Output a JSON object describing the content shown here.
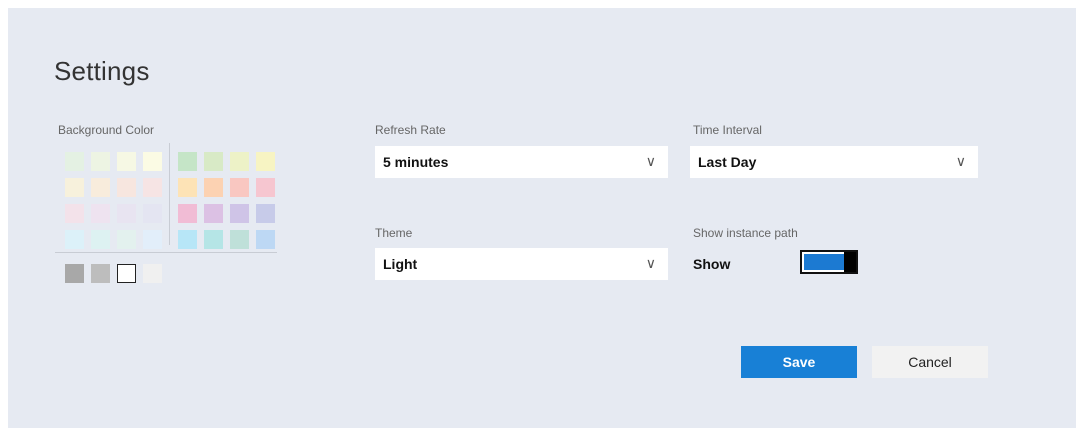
{
  "header": {
    "title": "Settings"
  },
  "background_color": {
    "label": "Background Color",
    "swatch_colors": {
      "row1_left": [
        "#e4f1e3",
        "#edf4e3",
        "#f6f8e4",
        "#fbfbe4"
      ],
      "row1_right": [
        "#c5e5c7",
        "#d8eac6",
        "#edf2c7",
        "#f7f4c3"
      ],
      "row2_left": [
        "#f7f1dc",
        "#f8ecdc",
        "#f7e6df",
        "#f6e4e4"
      ],
      "row2_right": [
        "#fde3b6",
        "#fcd2b2",
        "#f9c7c1",
        "#f6c6d0"
      ],
      "row3_left": [
        "#f3e2ea",
        "#eee3f0",
        "#e8e4f1",
        "#e4e5f2"
      ],
      "row3_right": [
        "#f1bcd5",
        "#dcc1e4",
        "#cfc4e7",
        "#c7cbe9"
      ],
      "row4_left": [
        "#dcf1f9",
        "#ddf2f2",
        "#e3f1ee",
        "#e2eefa"
      ],
      "row4_right": [
        "#b7e6f7",
        "#b5e5e6",
        "#bfe0d9",
        "#bdd8f4"
      ],
      "bottom": [
        "#a8a8a8",
        "#bdbdbd",
        "#ffffff",
        "#f0f0f0"
      ]
    }
  },
  "refresh_rate": {
    "label": "Refresh Rate",
    "value": "5 minutes"
  },
  "time_interval": {
    "label": "Time Interval",
    "value": "Last Day"
  },
  "theme": {
    "label": "Theme",
    "value": "Light"
  },
  "show_instance_path": {
    "label": "Show instance path",
    "value": "Show"
  },
  "colors": {
    "accent": "#1880d6",
    "toggle_fill": "#1c7ad2"
  },
  "buttons": {
    "save": "Save",
    "cancel": "Cancel"
  }
}
